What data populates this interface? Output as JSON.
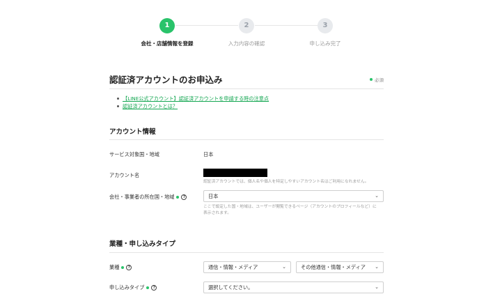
{
  "stepper": {
    "steps": [
      {
        "num": "1",
        "label": "会社・店舗情報を登録"
      },
      {
        "num": "2",
        "label": "入力内容の確認"
      },
      {
        "num": "3",
        "label": "申し込み完了"
      }
    ],
    "active_step": 1
  },
  "header": {
    "title": "認証済アカウントのお申込み",
    "required_legend": "必須"
  },
  "links": [
    {
      "label": "【LINE公式アカウント】認証済アカウントを申請する時の注意点"
    },
    {
      "label": "認証済アカウントとは？"
    }
  ],
  "account_section": {
    "heading": "アカウント情報",
    "service_region_label": "サービス対象国・地域",
    "service_region_value": "日本",
    "account_name_label": "アカウント名",
    "account_name_note": "認証済アカウントでは、個人名や個人を特定しやすいアカウント名はご利用になれません。",
    "location_label": "会社・事業者の所在国・地域",
    "location_value": "日本",
    "location_note_1": "ここで設定した国・地域は、ユーザーが閲覧できるページ（アカウントのプロフィールなど）に",
    "location_note_2": "表示されます。"
  },
  "industry_section": {
    "heading": "業種・申し込みタイプ",
    "industry_label": "業種",
    "industry_value_1": "通信・情報・メディア",
    "industry_value_2": "その他通信・情報・メディア",
    "apply_type_label": "申し込みタイプ",
    "apply_type_value": "選択してください。"
  },
  "colors": {
    "accent": "#29c36a",
    "link": "#12a650"
  },
  "icons": {
    "help": "?",
    "chevron": "⌄"
  }
}
